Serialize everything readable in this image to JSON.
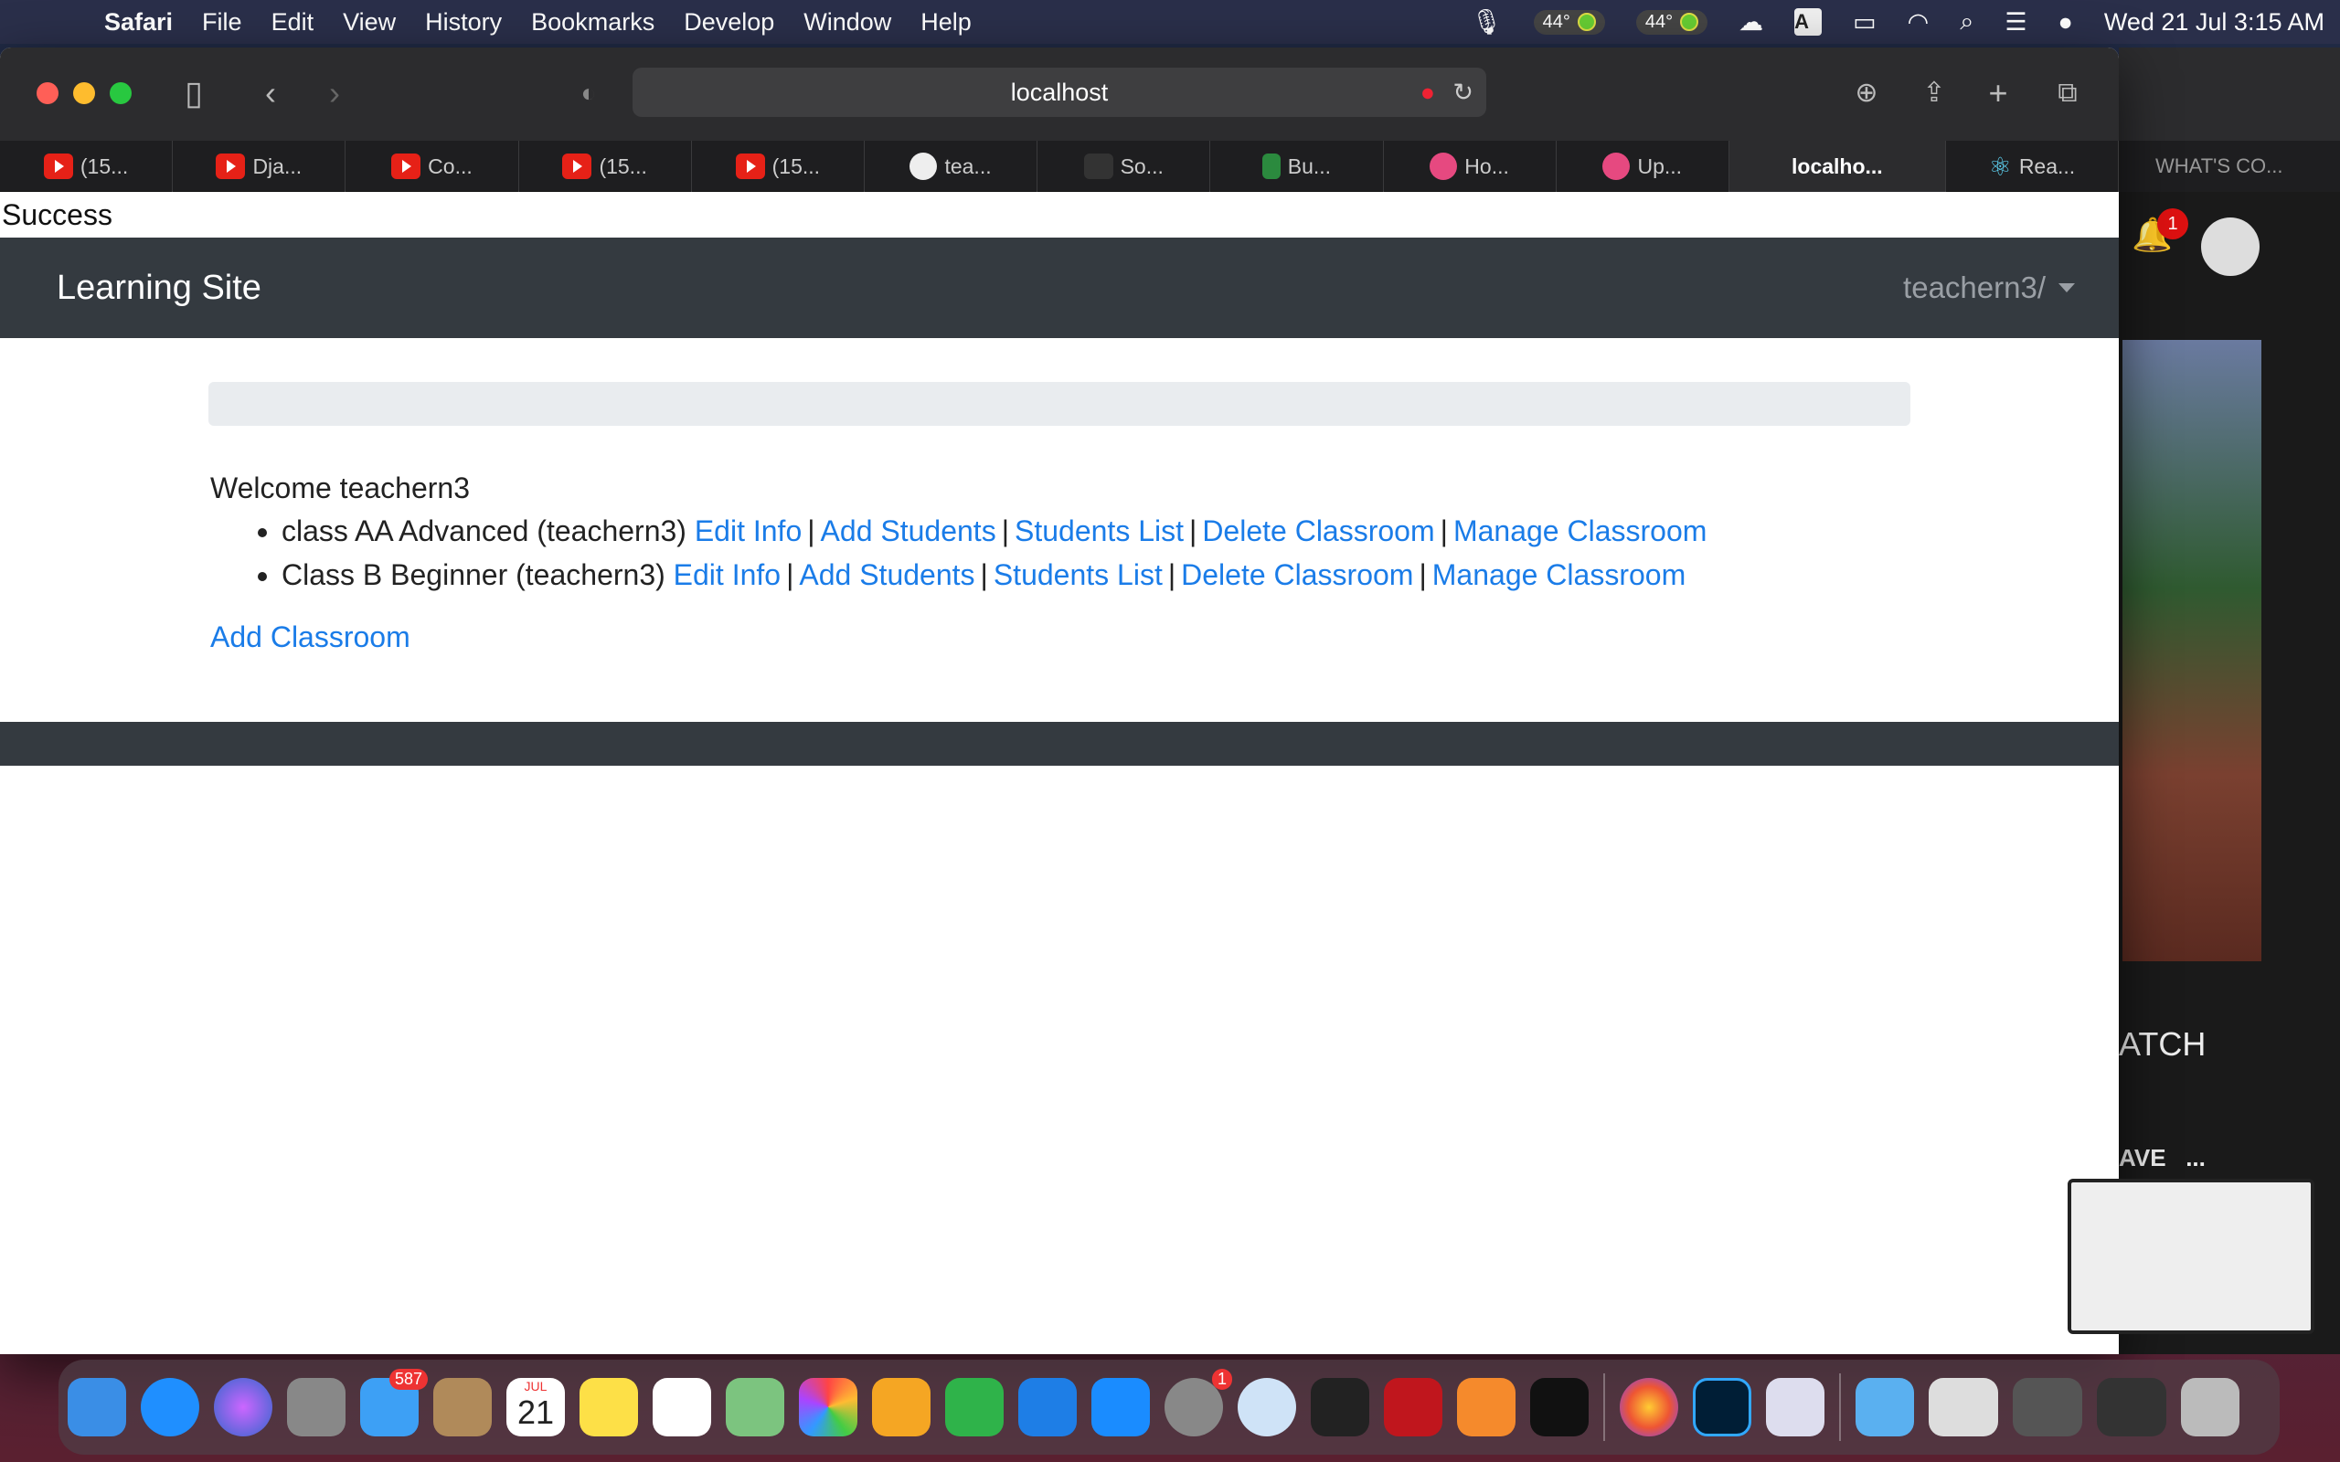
{
  "menubar": {
    "app": "Safari",
    "items": [
      "File",
      "Edit",
      "View",
      "History",
      "Bookmarks",
      "Develop",
      "Window",
      "Help"
    ],
    "temp1": "44°",
    "temp2": "44°",
    "input_source": "A",
    "datetime": "Wed 21 Jul  3:15 AM"
  },
  "browser": {
    "url": "localhost",
    "tabs": [
      {
        "label": "(15...",
        "icon": "youtube-icon"
      },
      {
        "label": "Dja...",
        "icon": "youtube-icon"
      },
      {
        "label": "Co...",
        "icon": "youtube-icon"
      },
      {
        "label": "(15...",
        "icon": "youtube-icon"
      },
      {
        "label": "(15...",
        "icon": "youtube-icon"
      },
      {
        "label": "tea...",
        "icon": "github-icon"
      },
      {
        "label": "So...",
        "icon": "dark-site-icon"
      },
      {
        "label": "Bu...",
        "icon": "green-site-icon"
      },
      {
        "label": "Ho...",
        "icon": "pink-play-icon"
      },
      {
        "label": "Up...",
        "icon": "pink-play-icon"
      },
      {
        "label": "localho...",
        "icon": "",
        "active": true
      },
      {
        "label": "Rea...",
        "icon": "react-icon"
      }
    ]
  },
  "page": {
    "flash": "Success",
    "brand": "Learning Site",
    "user_menu": "teachern3/",
    "welcome": "Welcome teachern3",
    "classes": [
      {
        "name": "class AA Advanced (teachern3)",
        "links": [
          "Edit Info",
          "Add Students",
          "Students List",
          "Delete Classroom",
          "Manage Classroom"
        ]
      },
      {
        "name": "Class B Beginner (teachern3)",
        "links": [
          "Edit Info",
          "Add Students",
          "Students List",
          "Delete Classroom",
          "Manage Classroom"
        ]
      }
    ],
    "separator": "|",
    "add_classroom": "Add Classroom"
  },
  "side_window": {
    "tab_label": "WHAT'S CO...",
    "notification_count": "1",
    "watch_text": "ATCH",
    "save_text": "AVE",
    "more": "..."
  },
  "dock": {
    "mail_badge": "587",
    "calendar_month": "JUL",
    "calendar_day": "21",
    "settings_badge": "1",
    "apps": [
      "finder-icon",
      "safari-icon",
      "siri-icon",
      "launchpad-icon",
      "mail-icon",
      "contacts-icon",
      "calendar-icon",
      "notes-icon",
      "reminders-icon",
      "maps-icon",
      "photos-icon",
      "pages-icon",
      "numbers-icon",
      "keynote-icon",
      "app-store-icon",
      "system-preferences-icon",
      "no-entry-icon",
      "terminal-icon",
      "acrobat-icon",
      "sublime-icon",
      "apple-tv-icon",
      "firefox-icon",
      "photoshop-icon",
      "preview-icon",
      "downloads-icon",
      "window-thumb-icon",
      "window-thumb-icon",
      "window-thumb-icon",
      "trash-icon"
    ]
  }
}
